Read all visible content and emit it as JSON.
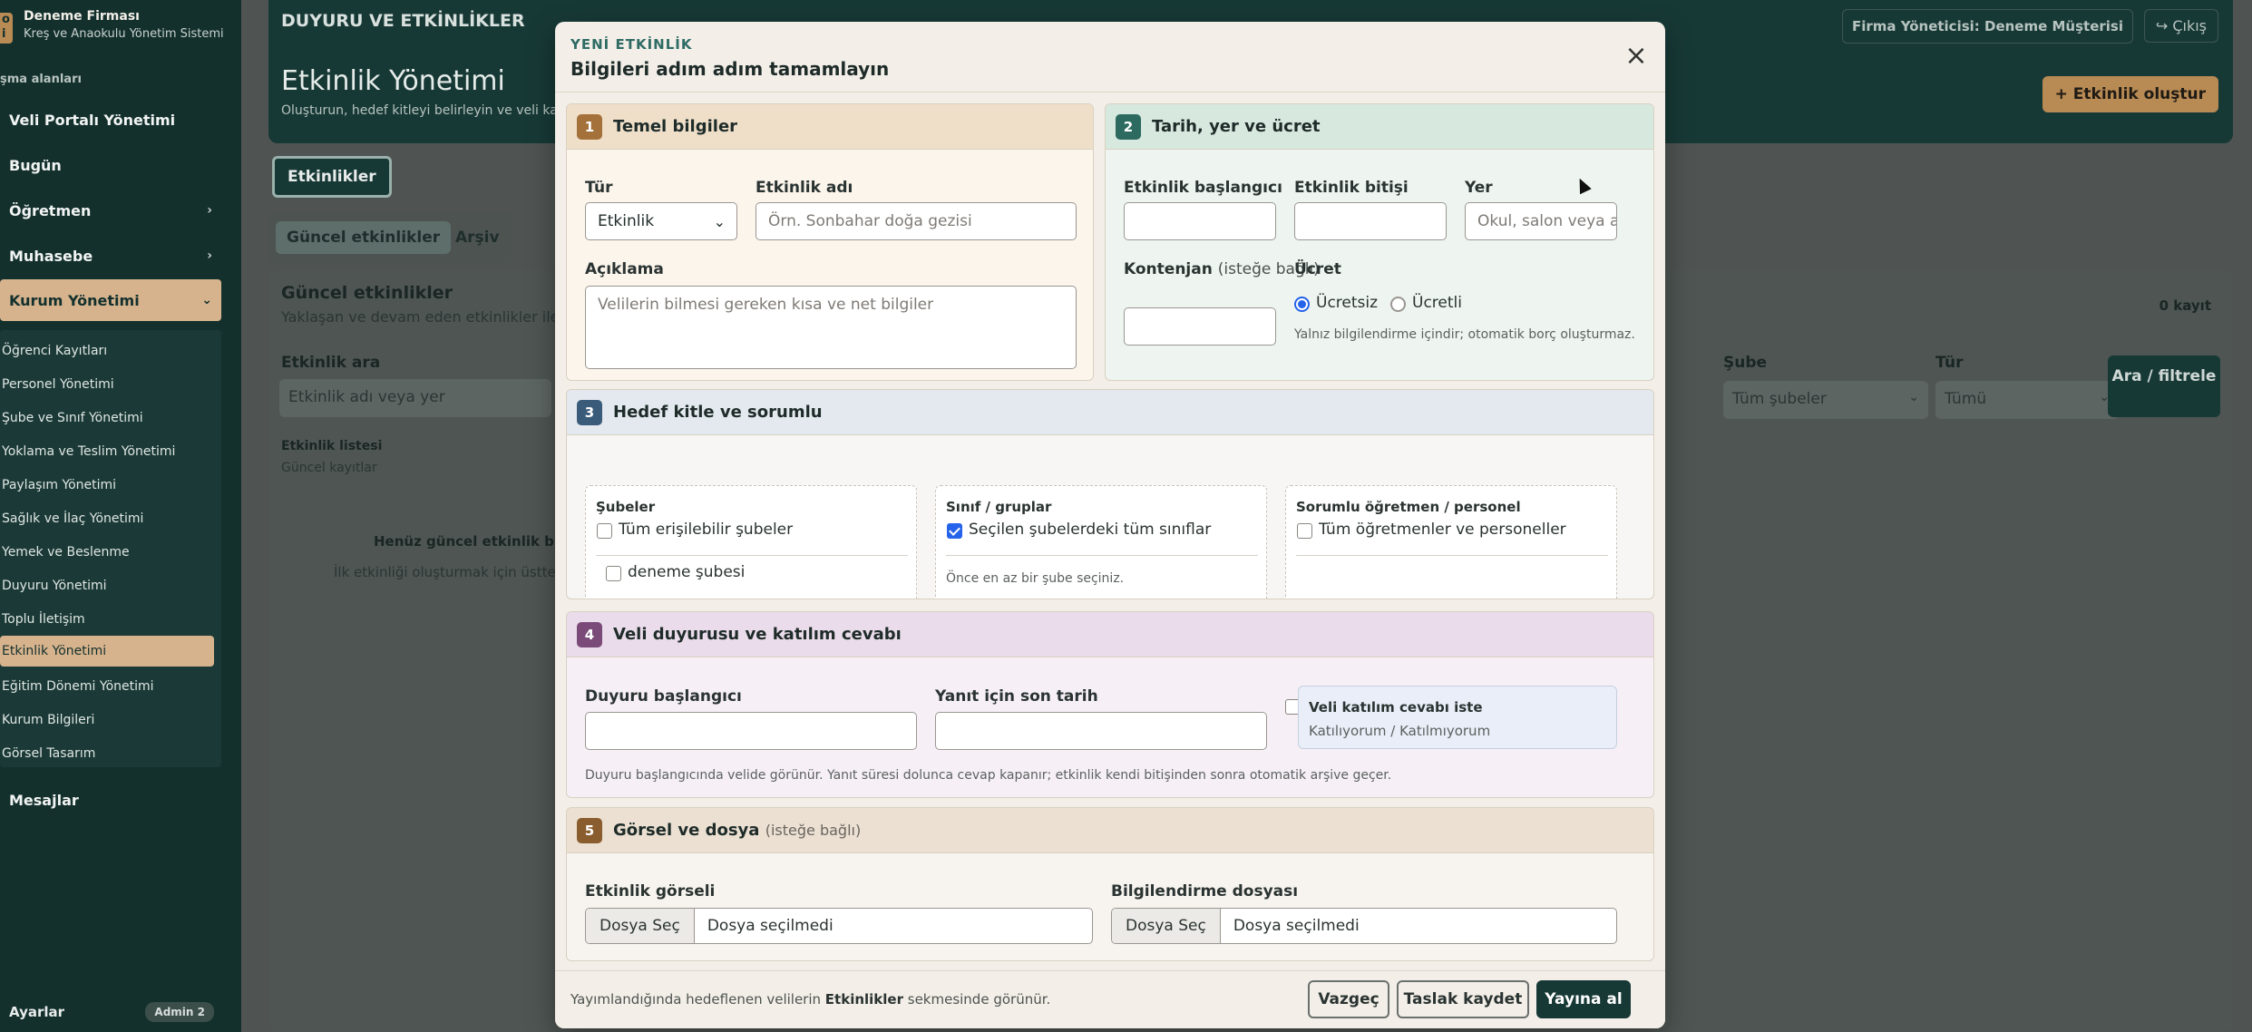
{
  "sidebar": {
    "brand_logo": "o\ni",
    "brand_name": "Deneme Firması",
    "brand_sub": "Kreş ve Anaokulu Yönetim Sistemi",
    "section_label": "şma alanları",
    "top_items": [
      {
        "label": "Veli Portalı Yönetimi"
      },
      {
        "label": "Bugün"
      },
      {
        "label": "Öğretmen",
        "chevron": "›"
      },
      {
        "label": "Muhasebe",
        "chevron": "›"
      },
      {
        "label": "Kurum Yönetimi",
        "chevron": "⌄"
      }
    ],
    "sub_items": [
      "Öğrenci Kayıtları",
      "Personel Yönetimi",
      "Şube ve Sınıf Yönetimi",
      "Yoklama ve Teslim Yönetimi",
      "Paylaşım Yönetimi",
      "Sağlık ve İlaç Yönetimi",
      "Yemek ve Beslenme",
      "Duyuru Yönetimi",
      "Toplu İletişim",
      "Etkinlik Yönetimi",
      "Eğitim Dönemi Yönetimi",
      "Kurum Bilgileri",
      "Görsel Tasarım"
    ],
    "messages": "Mesajlar",
    "settings": "Ayarlar",
    "admin_badge": "Admin 2"
  },
  "background": {
    "section": "DUYURU VE ETKİNLİKLER",
    "title": "Etkinlik Yönetimi",
    "desc": "Oluşturun, hedef kitleyi belirleyin ve veli katılı",
    "user": "Firma Yöneticisi: Deneme Müşterisi",
    "logout": "↪ Çıkış",
    "create": "+ Etkinlik oluştur",
    "main_tab": "Etkinlikler",
    "sub_tabs": [
      "Güncel etkinlikler",
      "Arşiv"
    ],
    "card_title": "Güncel etkinlikler",
    "card_sub": "Yaklaşan ve devam eden etkinlikler ile t",
    "count": "0 kayıt",
    "search_label": "Etkinlik ara",
    "search_placeholder": "Etkinlik adı veya yer",
    "list_title": "Etkinlik listesi",
    "list_sub": "Güncel kayıtlar",
    "empty_title": "Henüz güncel etkinlik bulun",
    "empty_sub": "İlk etkinliği oluşturmak için üstteki bu",
    "sube_label": "Şube",
    "sube_value": "Tüm şubeler",
    "tur_label": "Tür",
    "tur_value": "Tümü",
    "filter_btn": "Ara / filtrele"
  },
  "modal": {
    "kicker": "YENİ ETKİNLİK",
    "title": "Bilgileri adım adım tamamlayın",
    "close": "×",
    "p1": {
      "step": "1",
      "title": "Temel bilgiler",
      "type_label": "Tür",
      "type_value": "Etkinlik",
      "name_label": "Etkinlik adı",
      "name_placeholder": "Örn. Sonbahar doğa gezisi",
      "desc_label": "Açıklama",
      "desc_placeholder": "Velilerin bilmesi gereken kısa ve net bilgiler"
    },
    "p2": {
      "step": "2",
      "title": "Tarih, yer ve ücret",
      "start_label": "Etkinlik başlangıcı",
      "end_label": "Etkinlik bitişi",
      "place_label": "Yer",
      "place_placeholder": "Okul, salon veya adres",
      "quota_label": "Kontenjan",
      "quota_opt": "(isteğe bağlı)",
      "fee_label": "Ücret",
      "fee_free": "Ücretsiz",
      "fee_paid": "Ücretli",
      "fee_hint": "Yalnız bilgilendirme içindir; otomatik borç oluşturmaz."
    },
    "p3": {
      "step": "3",
      "title": "Hedef kitle ve sorumlu",
      "branches_title": "Şubeler",
      "branches_all": "Tüm erişilebilir şubeler",
      "branch_1": "deneme şubesi",
      "classes_title": "Sınıf / gruplar",
      "classes_all": "Seçilen şubelerdeki tüm sınıflar",
      "classes_hint": "Önce en az bir şube seçiniz.",
      "resp_title": "Sorumlu öğretmen / personel",
      "resp_all": "Tüm öğretmenler ve personeller"
    },
    "p4": {
      "step": "4",
      "title": "Veli duyurusu ve katılım cevabı",
      "announce_label": "Duyuru başlangıcı",
      "deadline_label": "Yanıt için son tarih",
      "rsvp_label": "Veli katılım cevabı iste",
      "rsvp_sub": "Katılıyorum / Katılmıyorum",
      "hint": "Duyuru başlangıcında velide görünür. Yanıt süresi dolunca cevap kapanır; etkinlik kendi bitişinden sonra otomatik arşive geçer."
    },
    "p5": {
      "step": "5",
      "title": "Görsel ve dosya",
      "title_opt": "(isteğe bağlı)",
      "image_label": "Etkinlik görseli",
      "doc_label": "Bilgilendirme dosyası",
      "choose": "Dosya Seç",
      "none": "Dosya seçilmedi"
    },
    "footer": {
      "note_pre": "Yayımlandığında hedeflenen velilerin ",
      "note_bold": "Etkinlikler",
      "note_post": " sekmesinde görünür.",
      "cancel": "Vazgeç",
      "draft": "Taslak kaydet",
      "publish": "Yayına al"
    }
  }
}
